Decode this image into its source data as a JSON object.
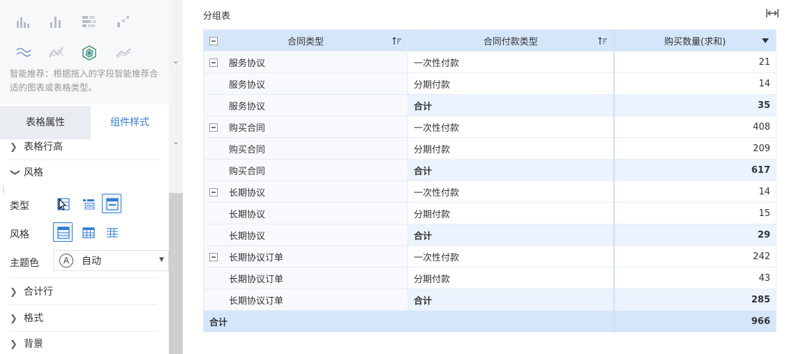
{
  "left_panel": {
    "chart_icons": [
      "bar-chart-icon",
      "column-chart-icon",
      "stacked-bar-icon",
      "scatter-icon",
      "wave-line-icon",
      "area-line-icon",
      "radar-icon",
      "multi-line-icon"
    ],
    "hint": "智能推荐：根据拖入的字段智能推荐合适的图表或表格类型。",
    "tabs": [
      "表格属性",
      "组件样式"
    ],
    "sections": {
      "row_height": "表格行高",
      "style": "风格",
      "subtotal_row": "合计行",
      "format": "格式",
      "background": "背景"
    },
    "props": {
      "type_label": "类型",
      "style_label": "风格",
      "theme_label": "主题色",
      "theme_value": "自动",
      "theme_icon_letter": "A"
    }
  },
  "main": {
    "title": "分组表",
    "columns": [
      "合同类型",
      "合同付款类型",
      "购买数量(求和)"
    ],
    "rows": [
      {
        "group": "服务协议",
        "type": "一次性付款",
        "value": "21",
        "first": true,
        "sub": false
      },
      {
        "group": "服务协议",
        "type": "分期付款",
        "value": "14",
        "first": false,
        "sub": false
      },
      {
        "group": "服务协议",
        "type": "合计",
        "value": "35",
        "first": false,
        "sub": true
      },
      {
        "group": "购买合同",
        "type": "一次性付款",
        "value": "408",
        "first": true,
        "sub": false
      },
      {
        "group": "购买合同",
        "type": "分期付款",
        "value": "209",
        "first": false,
        "sub": false
      },
      {
        "group": "购买合同",
        "type": "合计",
        "value": "617",
        "first": false,
        "sub": true
      },
      {
        "group": "长期协议",
        "type": "一次性付款",
        "value": "14",
        "first": true,
        "sub": false
      },
      {
        "group": "长期协议",
        "type": "分期付款",
        "value": "15",
        "first": false,
        "sub": false
      },
      {
        "group": "长期协议",
        "type": "合计",
        "value": "29",
        "first": false,
        "sub": true
      },
      {
        "group": "长期协议订单",
        "type": "一次性付款",
        "value": "242",
        "first": true,
        "sub": false
      },
      {
        "group": "长期协议订单",
        "type": "分期付款",
        "value": "43",
        "first": false,
        "sub": false
      },
      {
        "group": "长期协议订单",
        "type": "合计",
        "value": "285",
        "first": false,
        "sub": true
      }
    ],
    "total_label": "合计",
    "total_value": "966"
  },
  "colors": {
    "accent": "#2f7bd8",
    "header_bg": "#d5e6fb",
    "subtotal_bg": "#eaf3fe"
  }
}
